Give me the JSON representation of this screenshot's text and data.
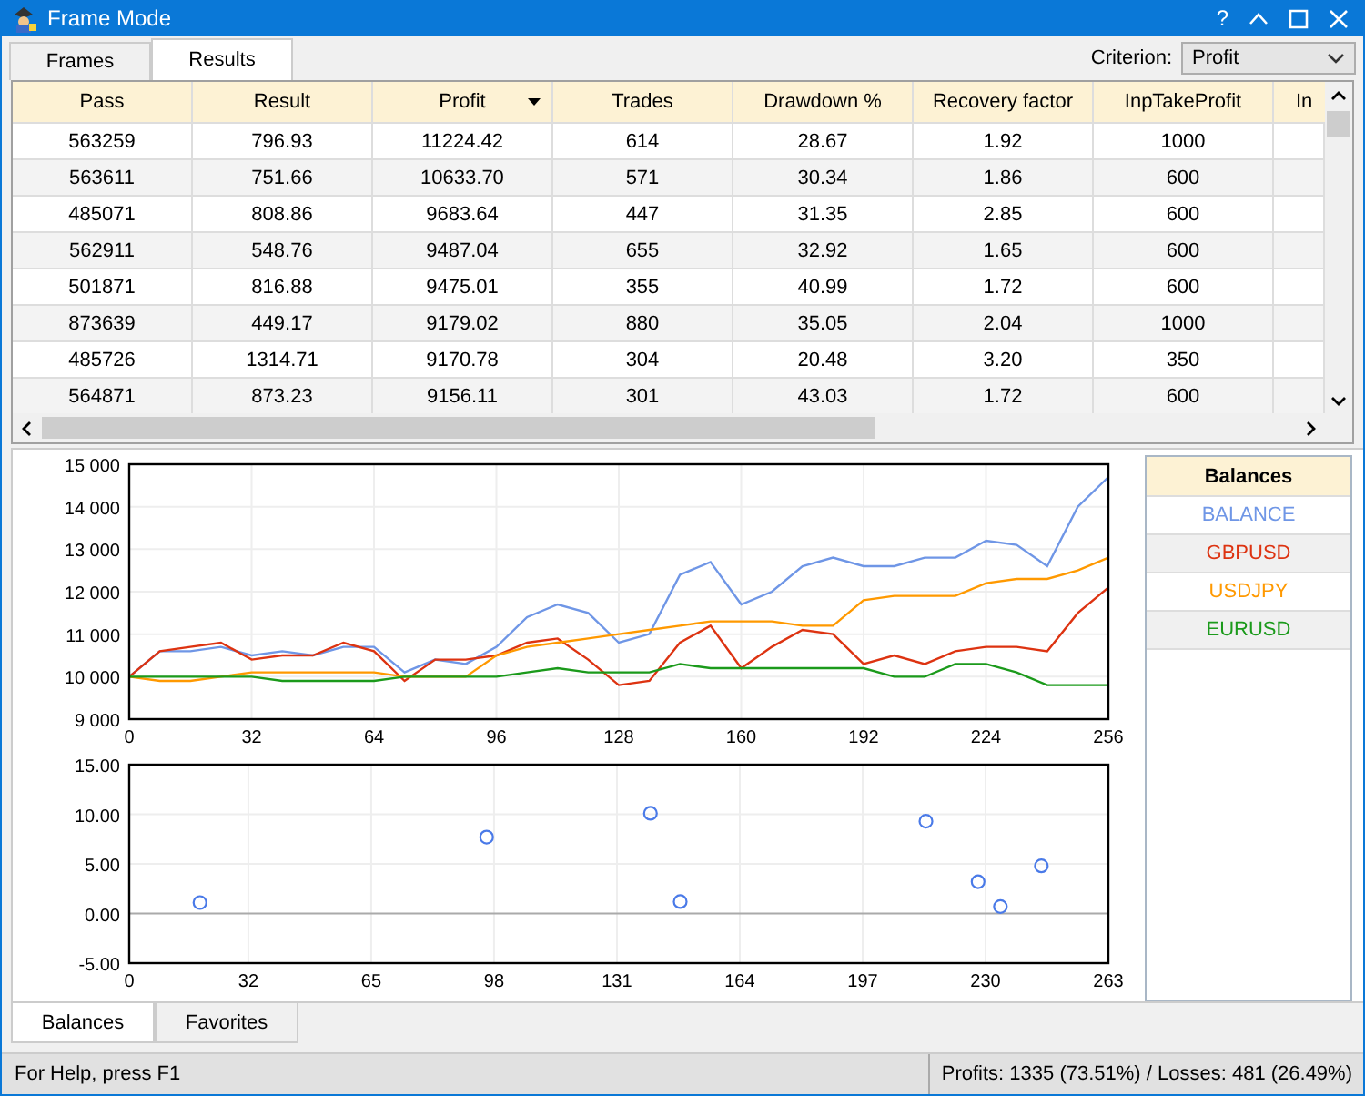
{
  "window": {
    "title": "Frame Mode",
    "help": "?"
  },
  "tabs": [
    {
      "label": "Frames",
      "selected": false
    },
    {
      "label": "Results",
      "selected": true
    }
  ],
  "criterion": {
    "label": "Criterion:",
    "value": "Profit"
  },
  "table": {
    "columns": [
      {
        "label": "Pass",
        "sorted": false
      },
      {
        "label": "Result",
        "sorted": false
      },
      {
        "label": "Profit",
        "sorted": true
      },
      {
        "label": "Trades",
        "sorted": false
      },
      {
        "label": "Drawdown %",
        "sorted": false
      },
      {
        "label": "Recovery factor",
        "sorted": false
      },
      {
        "label": "InpTakeProfit",
        "sorted": false
      },
      {
        "label": "In",
        "sorted": false
      }
    ],
    "rows": [
      [
        "563259",
        "796.93",
        "11224.42",
        "614",
        "28.67",
        "1.92",
        "1000"
      ],
      [
        "563611",
        "751.66",
        "10633.70",
        "571",
        "30.34",
        "1.86",
        "600"
      ],
      [
        "485071",
        "808.86",
        "9683.64",
        "447",
        "31.35",
        "2.85",
        "600"
      ],
      [
        "562911",
        "548.76",
        "9487.04",
        "655",
        "32.92",
        "1.65",
        "600"
      ],
      [
        "501871",
        "816.88",
        "9475.01",
        "355",
        "40.99",
        "1.72",
        "600"
      ],
      [
        "873639",
        "449.17",
        "9179.02",
        "880",
        "35.05",
        "2.04",
        "1000"
      ],
      [
        "485726",
        "1314.71",
        "9170.78",
        "304",
        "20.48",
        "3.20",
        "350"
      ],
      [
        "564871",
        "873.23",
        "9156.11",
        "301",
        "43.03",
        "1.72",
        "600"
      ]
    ]
  },
  "balance_chart": {
    "chart_data": {
      "type": "line",
      "x": [
        0,
        8,
        16,
        24,
        32,
        40,
        48,
        56,
        64,
        72,
        80,
        88,
        96,
        104,
        112,
        120,
        128,
        136,
        144,
        152,
        160,
        168,
        176,
        184,
        192,
        200,
        208,
        216,
        224,
        232,
        240,
        248,
        256
      ],
      "series": [
        {
          "name": "BALANCE",
          "color": "#6f96e6",
          "values": [
            10000,
            10600,
            10600,
            10700,
            10500,
            10600,
            10500,
            10700,
            10700,
            10100,
            10400,
            10300,
            10700,
            11400,
            11700,
            11500,
            10800,
            11000,
            12400,
            12700,
            11700,
            12000,
            12600,
            12800,
            12600,
            12600,
            12800,
            12800,
            13200,
            13100,
            12600,
            14000,
            14700
          ]
        },
        {
          "name": "GBPUSD",
          "color": "#dd3311",
          "values": [
            10000,
            10600,
            10700,
            10800,
            10400,
            10500,
            10500,
            10800,
            10600,
            9900,
            10400,
            10400,
            10500,
            10800,
            10900,
            10400,
            9800,
            9900,
            10800,
            11200,
            10200,
            10700,
            11100,
            11000,
            10300,
            10500,
            10300,
            10600,
            10700,
            10700,
            10600,
            11500,
            12100
          ]
        },
        {
          "name": "USDJPY",
          "color": "#ff9900",
          "values": [
            10000,
            9900,
            9900,
            10000,
            10100,
            10100,
            10100,
            10100,
            10100,
            10000,
            10000,
            10000,
            10500,
            10700,
            10800,
            10900,
            11000,
            11100,
            11200,
            11300,
            11300,
            11300,
            11200,
            11200,
            11800,
            11900,
            11900,
            11900,
            12200,
            12300,
            12300,
            12500,
            12800
          ]
        },
        {
          "name": "EURUSD",
          "color": "#1b9a1b",
          "values": [
            10000,
            10000,
            10000,
            10000,
            10000,
            9900,
            9900,
            9900,
            9900,
            10000,
            10000,
            10000,
            10000,
            10100,
            10200,
            10100,
            10100,
            10100,
            10300,
            10200,
            10200,
            10200,
            10200,
            10200,
            10200,
            10000,
            10000,
            10300,
            10300,
            10100,
            9800,
            9800,
            9800
          ]
        }
      ],
      "xlim": [
        0,
        256
      ],
      "ylim": [
        9000,
        15000
      ],
      "grid": true,
      "xticks": [
        0,
        32,
        64,
        96,
        128,
        160,
        192,
        224,
        256
      ],
      "yticks": [
        {
          "value": 9000,
          "label": "9 000"
        },
        {
          "value": 10000,
          "label": "10 000"
        },
        {
          "value": 11000,
          "label": "11 000"
        },
        {
          "value": 12000,
          "label": "12 000"
        },
        {
          "value": 13000,
          "label": "13 000"
        },
        {
          "value": 14000,
          "label": "14 000"
        },
        {
          "value": 15000,
          "label": "15 000"
        }
      ]
    }
  },
  "profit_chart": {
    "chart_data": {
      "type": "scatter",
      "x": [
        19,
        96,
        140,
        148,
        214,
        228,
        234,
        245
      ],
      "series": [
        {
          "color": "#4a7ae8",
          "values": [
            1.1,
            7.7,
            10.1,
            1.2,
            9.3,
            3.2,
            0.7,
            4.8
          ]
        }
      ],
      "xlim": [
        0,
        263
      ],
      "ylim": [
        -5,
        15
      ],
      "grid": true,
      "xticks": [
        0,
        32,
        65,
        98,
        131,
        164,
        197,
        230,
        263
      ],
      "yticks": [
        {
          "value": -5,
          "label": "-5.00"
        },
        {
          "value": 0,
          "label": "0.00"
        },
        {
          "value": 5,
          "label": "5.00"
        },
        {
          "value": 10,
          "label": "10.00"
        },
        {
          "value": 15,
          "label": "15.00"
        }
      ]
    }
  },
  "legend": {
    "title": "Balances"
  },
  "bottom_tabs": [
    {
      "label": "Balances",
      "selected": true
    },
    {
      "label": "Favorites",
      "selected": false
    }
  ],
  "status_bar": {
    "help": "For Help, press F1",
    "summary": "Profits: 1335 (73.51%) / Losses: 481 (26.49%)"
  }
}
